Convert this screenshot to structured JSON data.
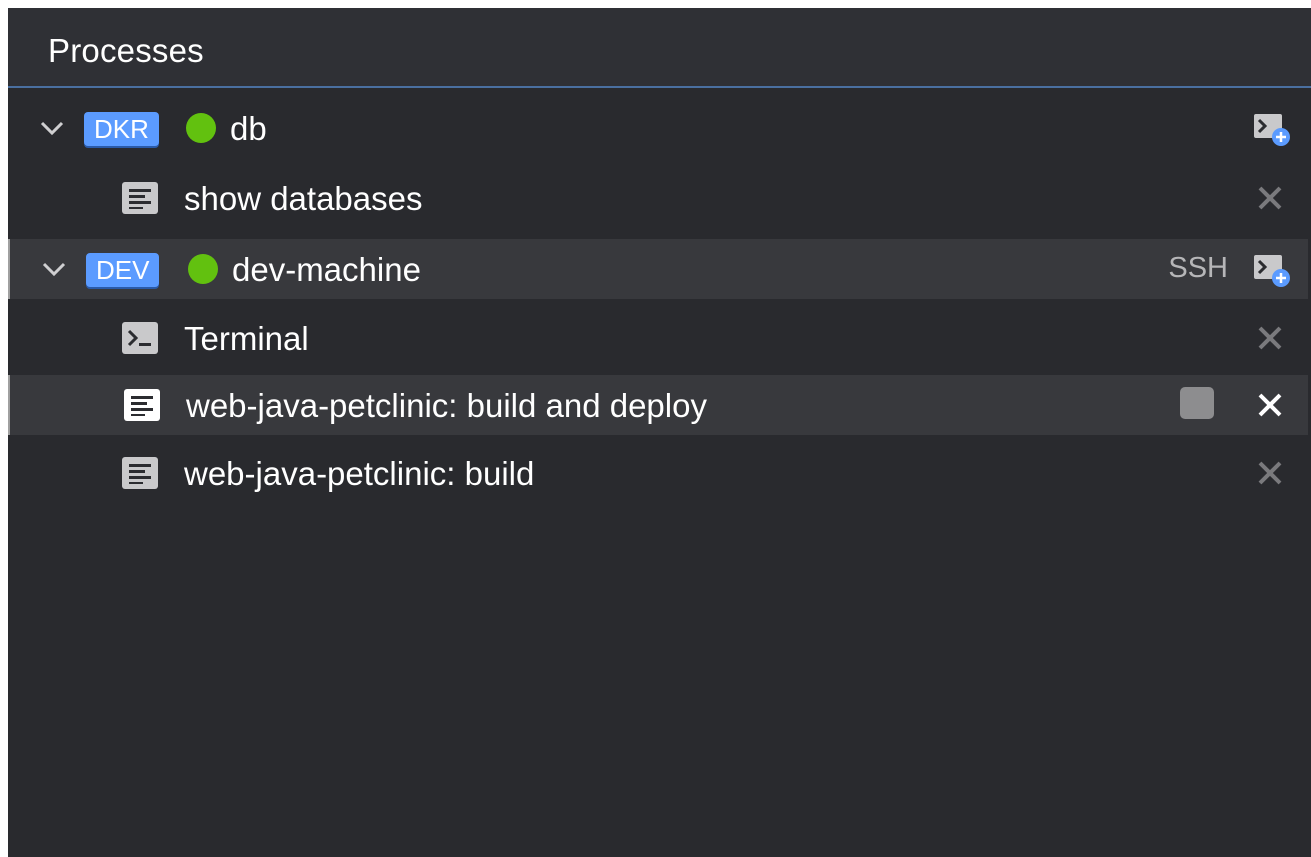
{
  "panel": {
    "title": "Processes"
  },
  "machines": [
    {
      "badge": "DKR",
      "name": "db",
      "status": "running",
      "status_color": "#62c10f",
      "badge_color": "#5b9bff",
      "ssh_label": "",
      "processes": [
        {
          "name": "show databases",
          "type": "command"
        }
      ]
    },
    {
      "badge": "DEV",
      "name": "dev-machine",
      "status": "running",
      "status_color": "#62c10f",
      "badge_color": "#5b9bff",
      "ssh_label": "SSH",
      "processes": [
        {
          "name": "Terminal",
          "type": "terminal"
        },
        {
          "name": "web-java-petclinic: build and deploy",
          "type": "command",
          "running": true
        },
        {
          "name": "web-java-petclinic: build",
          "type": "command"
        }
      ]
    }
  ],
  "icons": {
    "chevron": "chevron-down-icon",
    "command": "command-output-icon",
    "terminal": "terminal-icon",
    "add_terminal": "add-terminal-icon",
    "close": "close-icon",
    "stop": "stop-icon"
  },
  "colors": {
    "panel_bg": "#292a2e",
    "header_bg": "#2f3035",
    "header_border": "#4a6fa0",
    "selected_row_bg": "#38393d",
    "accent_blue": "#5b9bff",
    "status_green": "#62c10f"
  }
}
